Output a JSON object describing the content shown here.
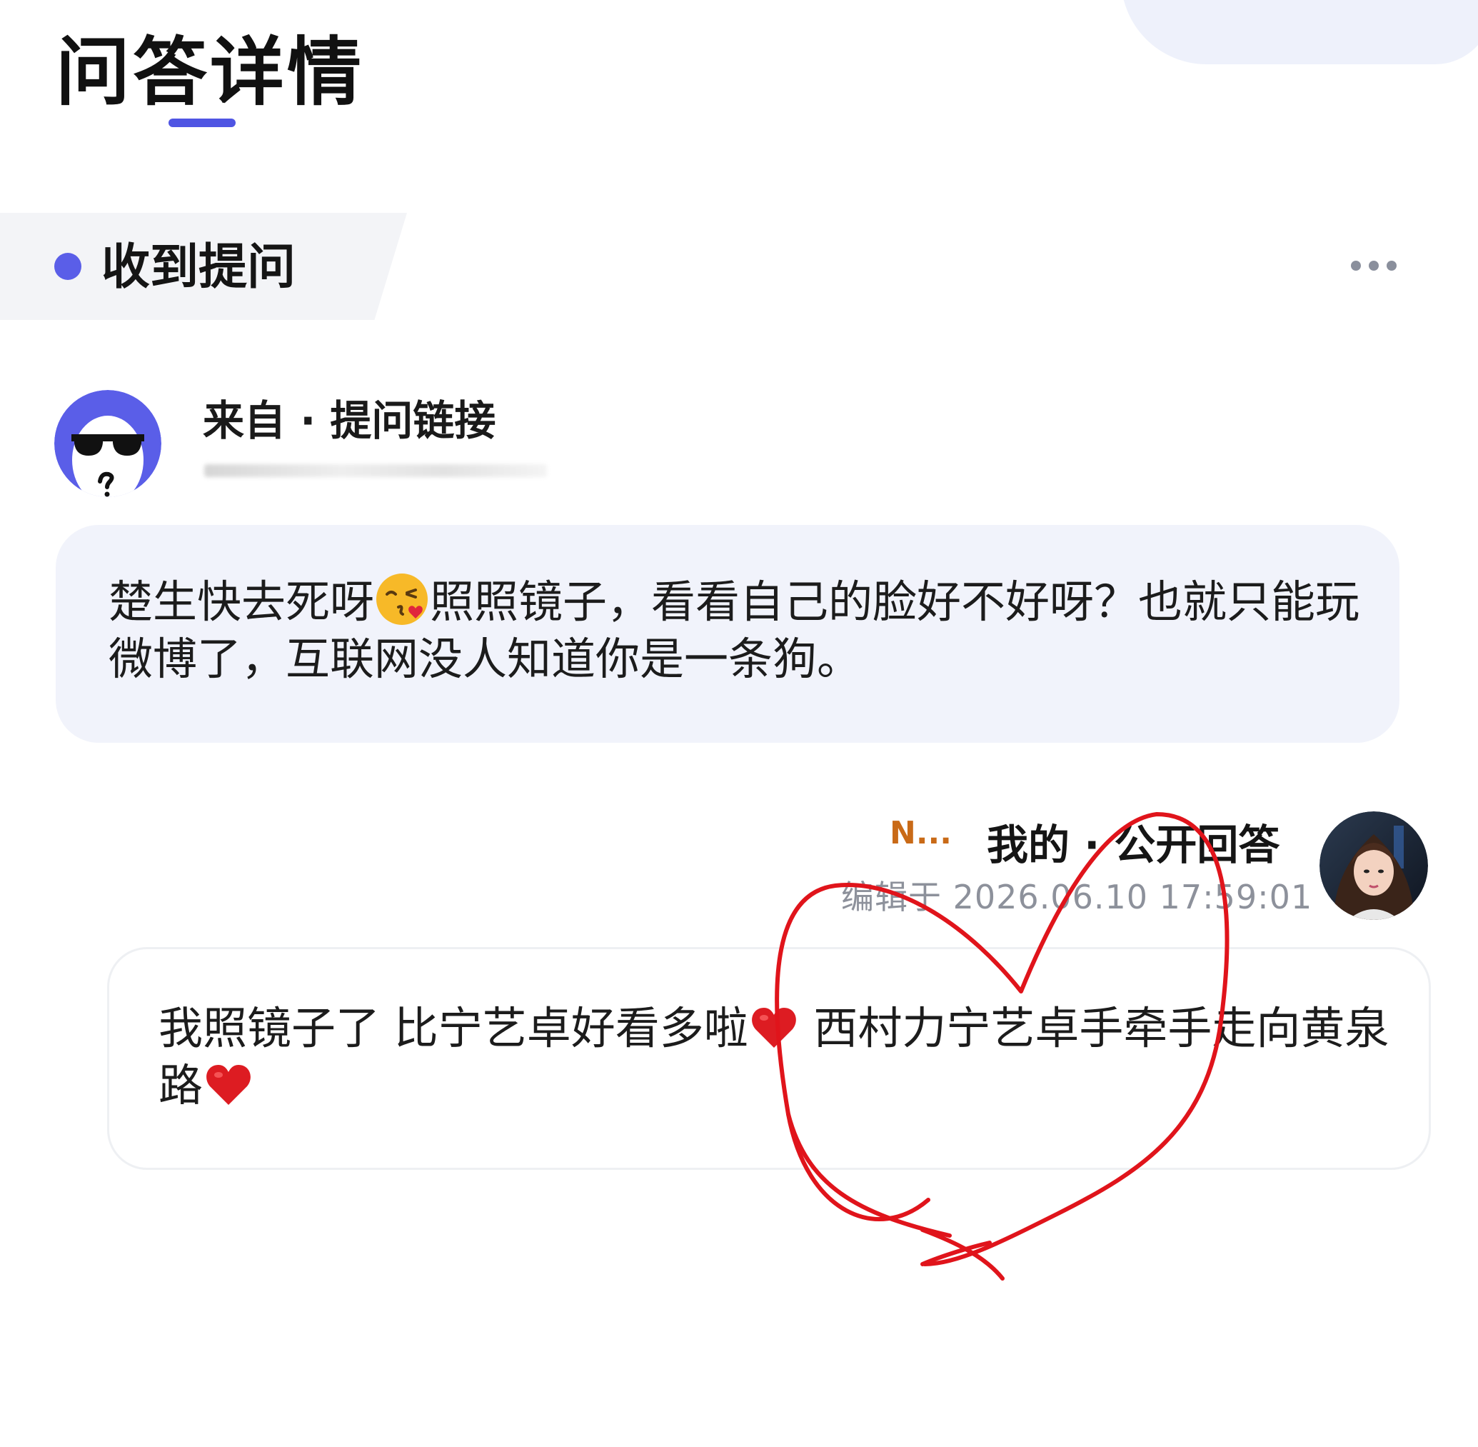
{
  "header": {
    "title": "问答详情"
  },
  "section": {
    "label": "收到提问",
    "more_icon": "more-horizontal-icon"
  },
  "question": {
    "from_label": "来自 · 提问链接",
    "text_part1": "楚生快去死呀",
    "text_part2": "照照镜子，看看自己的脸好不好呀？也就只能玩微博了，互联网没人知道你是一条狗。",
    "emoji": "kissing-heart-emoji"
  },
  "answer": {
    "user_tag": "N...",
    "label": "我的 · 公开回答",
    "edit_time": "编辑于 2026.06.10 17:59:01",
    "text_part1": "我照镜子了 比宁艺卓好看多啦",
    "text_part2": " 西村力宁艺卓手牵手走向黄泉路",
    "emoji": "red-heart-emoji"
  },
  "colors": {
    "accent": "#4f55e3",
    "dot": "#5a5ee8",
    "bubble": "#f1f3fb",
    "user_tag": "#c96a17",
    "scribble": "#e0141b"
  }
}
